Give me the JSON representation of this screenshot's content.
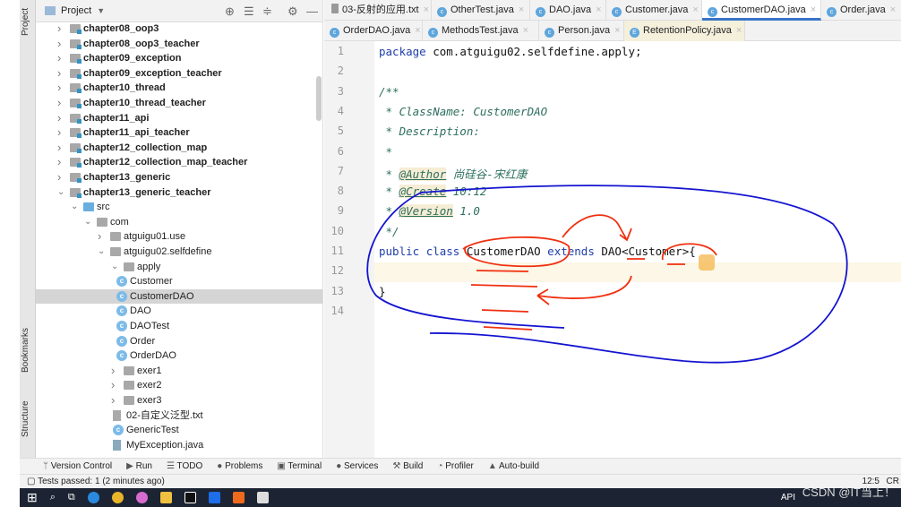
{
  "sidebar_strip": {
    "project": "Project",
    "bookmarks": "Bookmarks",
    "structure": "Structure"
  },
  "project_panel": {
    "title": "Project",
    "tree": [
      {
        "label": "chapter08_oop3",
        "depth": 0,
        "type": "module",
        "expanded": false
      },
      {
        "label": "chapter08_oop3_teacher",
        "depth": 0,
        "type": "module",
        "expanded": false
      },
      {
        "label": "chapter09_exception",
        "depth": 0,
        "type": "module",
        "expanded": false
      },
      {
        "label": "chapter09_exception_teacher",
        "depth": 0,
        "type": "module",
        "expanded": false
      },
      {
        "label": "chapter10_thread",
        "depth": 0,
        "type": "module",
        "expanded": false
      },
      {
        "label": "chapter10_thread_teacher",
        "depth": 0,
        "type": "module",
        "expanded": false
      },
      {
        "label": "chapter11_api",
        "depth": 0,
        "type": "module",
        "expanded": false
      },
      {
        "label": "chapter11_api_teacher",
        "depth": 0,
        "type": "module",
        "expanded": false
      },
      {
        "label": "chapter12_collection_map",
        "depth": 0,
        "type": "module",
        "expanded": false
      },
      {
        "label": "chapter12_collection_map_teacher",
        "depth": 0,
        "type": "module",
        "expanded": false
      },
      {
        "label": "chapter13_generic",
        "depth": 0,
        "type": "module",
        "expanded": false
      },
      {
        "label": "chapter13_generic_teacher",
        "depth": 0,
        "type": "module",
        "expanded": true
      },
      {
        "label": "src",
        "depth": 1,
        "type": "src",
        "expanded": true
      },
      {
        "label": "com",
        "depth": 2,
        "type": "package",
        "expanded": true
      },
      {
        "label": "atguigu01.use",
        "depth": 3,
        "type": "package",
        "expanded": false
      },
      {
        "label": "atguigu02.selfdefine",
        "depth": 3,
        "type": "package",
        "expanded": true
      },
      {
        "label": "apply",
        "depth": 4,
        "type": "package",
        "expanded": true
      },
      {
        "label": "Customer",
        "depth": 5,
        "type": "class"
      },
      {
        "label": "CustomerDAO",
        "depth": 5,
        "type": "class",
        "selected": true
      },
      {
        "label": "DAO",
        "depth": 5,
        "type": "class"
      },
      {
        "label": "DAOTest",
        "depth": 5,
        "type": "test"
      },
      {
        "label": "Order",
        "depth": 5,
        "type": "class"
      },
      {
        "label": "OrderDAO",
        "depth": 5,
        "type": "class"
      },
      {
        "label": "exer1",
        "depth": 4,
        "type": "package",
        "expanded": false
      },
      {
        "label": "exer2",
        "depth": 4,
        "type": "package",
        "expanded": false
      },
      {
        "label": "exer3",
        "depth": 4,
        "type": "package",
        "expanded": false
      },
      {
        "label": "02-自定义泛型.txt",
        "depth": 4,
        "type": "txt"
      },
      {
        "label": "GenericTest",
        "depth": 4,
        "type": "test"
      },
      {
        "label": "MyException.java",
        "depth": 4,
        "type": "java"
      }
    ]
  },
  "tabs_row1": [
    {
      "label": "03-反射的应用.txt",
      "icon": "txt"
    },
    {
      "label": "OtherTest.java",
      "icon": "class"
    },
    {
      "label": "DAO.java",
      "icon": "class"
    },
    {
      "label": "Customer.java",
      "icon": "class"
    },
    {
      "label": "CustomerDAO.java",
      "icon": "class",
      "active": true
    },
    {
      "label": "Order.java",
      "icon": "class"
    }
  ],
  "tabs_row2": [
    {
      "label": "OrderDAO.java",
      "icon": "class"
    },
    {
      "label": "MethodsTest.java",
      "icon": "class"
    },
    {
      "label": "Person.java",
      "icon": "class"
    },
    {
      "label": "RetentionPolicy.java",
      "icon": "enum"
    }
  ],
  "editor": {
    "lines": [
      "package com.atguigu02.selfdefine.apply;",
      "",
      "/**",
      " * ClassName: CustomerDAO",
      " * Description:",
      " *",
      " * @Author 尚硅谷-宋红康",
      " * @Create 10:12",
      " * @Version 1.0",
      " */",
      "public class CustomerDAO extends DAO<Customer>{",
      "",
      "}",
      ""
    ],
    "current_line": 12
  },
  "bottom_toolbar": [
    "Version Control",
    "Run",
    "TODO",
    "Problems",
    "Terminal",
    "Services",
    "Build",
    "Profiler",
    "Auto-build"
  ],
  "status": {
    "message": "Tests passed: 1 (2 minutes ago)",
    "position": "12:5",
    "line_sep": "CR"
  },
  "taskbar": {
    "api": "API",
    "watermark": "CSDN @IT当上！"
  },
  "colors": {
    "accent": "#3a74c8",
    "annotation_blue": "#1010d0",
    "annotation_red": "#f03010"
  }
}
